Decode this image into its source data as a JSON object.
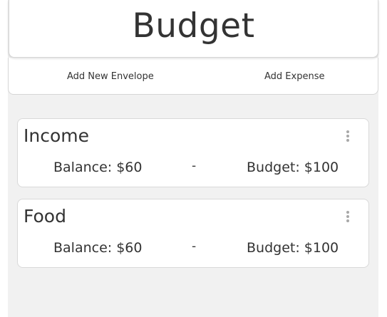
{
  "header": {
    "title": "Budget"
  },
  "nav": {
    "add_envelope_label": "Add New Envelope",
    "add_expense_label": "Add Expense"
  },
  "envelopes": [
    {
      "name": "Income",
      "balance_text": "Balance: $60",
      "separator": "-",
      "budget_text": "Budget: $100"
    },
    {
      "name": "Food",
      "balance_text": "Balance: $60",
      "separator": "-",
      "budget_text": "Budget: $100"
    }
  ],
  "icons": {
    "envelope_menu": "more-vertical-icon"
  },
  "colors": {
    "background": "#f1f1f1",
    "card": "#ffffff",
    "text": "#333333",
    "border": "#d9d9d9",
    "menu_icon": "#a8a8a8"
  }
}
